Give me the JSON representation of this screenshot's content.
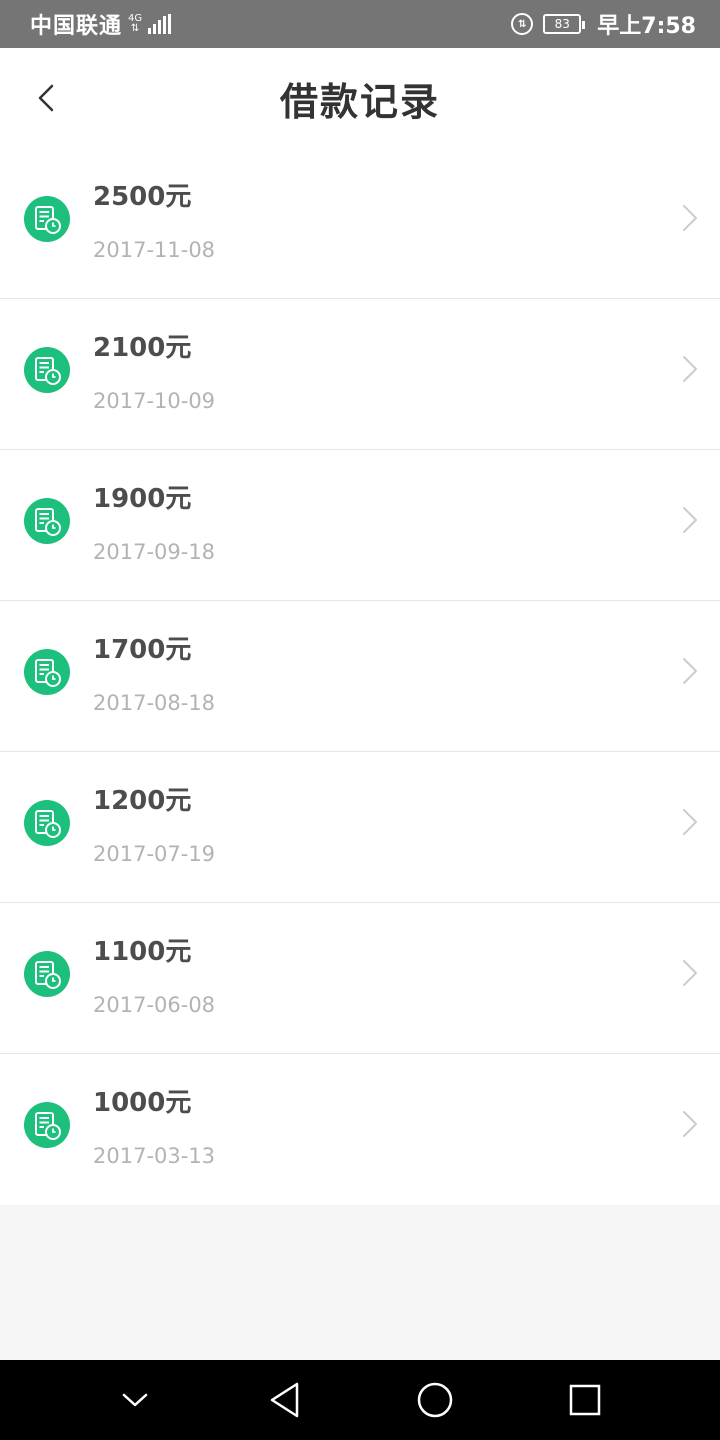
{
  "status_bar": {
    "carrier": "中国联通",
    "network": "4G",
    "battery": "83",
    "time": "早上7:58"
  },
  "header": {
    "title": "借款记录"
  },
  "records": [
    {
      "amount": "2500元",
      "date": "2017-11-08"
    },
    {
      "amount": "2100元",
      "date": "2017-10-09"
    },
    {
      "amount": "1900元",
      "date": "2017-09-18"
    },
    {
      "amount": "1700元",
      "date": "2017-08-18"
    },
    {
      "amount": "1200元",
      "date": "2017-07-19"
    },
    {
      "amount": "1100元",
      "date": "2017-06-08"
    },
    {
      "amount": "1000元",
      "date": "2017-03-13"
    }
  ],
  "colors": {
    "accent": "#1cbf7c",
    "status_bar": "#757575",
    "title": "#333333",
    "amount": "#4d4d4d",
    "date": "#b3b3b3"
  },
  "icons": {
    "back": "chevron-left-icon",
    "record": "record-clock-icon",
    "item_arrow": "chevron-right-icon"
  }
}
